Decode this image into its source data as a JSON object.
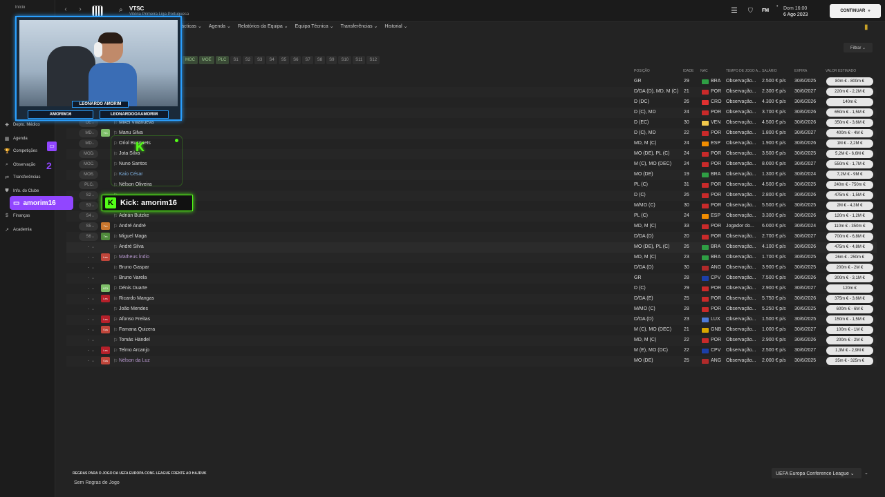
{
  "topbar": {
    "back": "‹",
    "forward": "›",
    "team_name": "VTSC",
    "team_sub": "Vitória Primeira Liga Portuguesa",
    "day": "Dom 16:00",
    "date": "6 Ago 2023",
    "fm_logo": "FM",
    "continue_label": "CONTINUAR",
    "continue_arrow": "»"
  },
  "tabs": [
    "Tácticas ⌄",
    "Agenda ⌄",
    "Relatórios da Equipa ⌄",
    "Equipa Técnica ⌄",
    "Transferências ⌄",
    "Historial ⌄"
  ],
  "filter_label": "Filtrar ⌄",
  "pos_filter": [
    {
      "label": "MOC",
      "on": true
    },
    {
      "label": "MOE",
      "on": true
    },
    {
      "label": "PLC",
      "on": true
    },
    {
      "label": "S1",
      "on": false
    },
    {
      "label": "S2",
      "on": false
    },
    {
      "label": "S3",
      "on": false
    },
    {
      "label": "S4",
      "on": false
    },
    {
      "label": "S5",
      "on": false
    },
    {
      "label": "S6",
      "on": false
    },
    {
      "label": "S7",
      "on": false
    },
    {
      "label": "S8",
      "on": false
    },
    {
      "label": "S9",
      "on": false
    },
    {
      "label": "S10",
      "on": false
    },
    {
      "label": "S11",
      "on": false
    },
    {
      "label": "S12",
      "on": false
    }
  ],
  "columns": {
    "posicao": "POSIÇÃO",
    "idade": "IDADE",
    "nac": "NAC",
    "tempo": "TEMPO DE JOGO A...",
    "salario": "SALÁRIO",
    "expira": "EXPIRA",
    "valor": "VALOR ESTIMADO"
  },
  "sidebar": {
    "top_label": "Início",
    "items": [
      {
        "label": "Depto. Médico",
        "icon": "✚"
      },
      {
        "label": "Agenda",
        "icon": "▦"
      },
      {
        "label": "Competições",
        "icon": "🏆"
      },
      {
        "label": "Observação",
        "icon": "⌕"
      },
      {
        "label": "Transferências",
        "icon": "⇄"
      },
      {
        "label": "Info. do Clube",
        "icon": "⛊"
      },
      {
        "label": "Finanças",
        "icon": "$"
      },
      {
        "label": "Academia",
        "icon": "↗"
      }
    ]
  },
  "players": [
    {
      "pos": "",
      "badge": "",
      "badge_color": "",
      "name": "",
      "position": "GR",
      "age": "29",
      "flag": "#2f9e44",
      "nat": "BRA",
      "status": "Observação...",
      "salary": "2.500 € p/s",
      "expires": "30/6/2025",
      "value": "80m € - 800m €",
      "style": ""
    },
    {
      "pos": "",
      "badge": "",
      "badge_color": "",
      "name": "",
      "position": "D/DA (D), MD, M (C)",
      "age": "21",
      "flag": "#c92a2a",
      "nat": "POR",
      "status": "Observação...",
      "salary": "2.300 € p/s",
      "expires": "30/6/2027",
      "value": "220m € - 2,2M €",
      "style": ""
    },
    {
      "pos": "",
      "badge": "",
      "badge_color": "",
      "name": "",
      "position": "D (DC)",
      "age": "26",
      "flag": "#e03131",
      "nat": "CRO",
      "status": "Observação...",
      "salary": "4.300 € p/s",
      "expires": "30/6/2026",
      "value": "140m €",
      "style": ""
    },
    {
      "pos": "",
      "badge": "",
      "badge_color": "",
      "name": "",
      "position": "D (C), MD",
      "age": "24",
      "flag": "#c92a2a",
      "nat": "POR",
      "status": "Observação...",
      "salary": "3.700 € p/s",
      "expires": "30/6/2026",
      "value": "650m € - 1,5M €",
      "style": ""
    },
    {
      "pos": "DE",
      "badge": "",
      "badge_color": "",
      "name": "Mikel Villanueva",
      "position": "D (EC)",
      "age": "30",
      "flag": "#f2c94c",
      "nat": "VEN",
      "status": "Observação...",
      "salary": "4.500 € p/s",
      "expires": "30/6/2026",
      "value": "350m € - 3,6M €",
      "style": ""
    },
    {
      "pos": "MD",
      "badge": "Trn",
      "badge_color": "#7fbf6a",
      "name": "Manu Silva",
      "position": "D (C), MD",
      "age": "22",
      "flag": "#c92a2a",
      "nat": "POR",
      "status": "Observação...",
      "salary": "1.800 € p/s",
      "expires": "30/6/2027",
      "value": "400m € - 4M €",
      "style": ""
    },
    {
      "pos": "MD",
      "badge": "",
      "badge_color": "",
      "name": "Oriol Busquets",
      "position": "MD, M (C)",
      "age": "24",
      "flag": "#f08c00",
      "nat": "ESP",
      "status": "Observação...",
      "salary": "1.900 € p/s",
      "expires": "30/6/2026",
      "value": "1M € - 2,2M €",
      "style": ""
    },
    {
      "pos": "MOD",
      "badge": "",
      "badge_color": "",
      "name": "Jota Silva",
      "position": "MO (DE), PL (C)",
      "age": "24",
      "flag": "#c92a2a",
      "nat": "POR",
      "status": "Observação...",
      "salary": "3.500 € p/s",
      "expires": "30/6/2025",
      "value": "5,2M € - 6,6M €",
      "style": ""
    },
    {
      "pos": "MOC",
      "badge": "",
      "badge_color": "",
      "name": "Nuno Santos",
      "position": "M (C), MO (DEC)",
      "age": "24",
      "flag": "#c92a2a",
      "nat": "POR",
      "status": "Observação...",
      "salary": "8.000 € p/s",
      "expires": "30/6/2027",
      "value": "550m € - 1,7M €",
      "style": ""
    },
    {
      "pos": "MOE",
      "badge": "",
      "badge_color": "",
      "name": "Kaio César",
      "position": "MO (DE)",
      "age": "19",
      "flag": "#2f9e44",
      "nat": "BRA",
      "status": "Observação...",
      "salary": "1.300 € p/s",
      "expires": "30/6/2024",
      "value": "7,2M € - 9M €",
      "style": "blue"
    },
    {
      "pos": "PLC",
      "badge": "",
      "badge_color": "",
      "name": "Nélson Oliveira",
      "position": "PL (C)",
      "age": "31",
      "flag": "#c92a2a",
      "nat": "POR",
      "status": "Observação...",
      "salary": "4.500 € p/s",
      "expires": "30/6/2025",
      "value": "240m € - 750m €",
      "style": ""
    },
    {
      "pos": "S2",
      "badge": "",
      "badge_color": "",
      "name": "",
      "position": "D (C)",
      "age": "26",
      "flag": "#c92a2a",
      "nat": "POR",
      "status": "Observação...",
      "salary": "2.800 € p/s",
      "expires": "30/6/2026",
      "value": "475m € - 1,5M €",
      "style": ""
    },
    {
      "pos": "S3",
      "badge": "",
      "badge_color": "",
      "name": "",
      "position": "M/MO (C)",
      "age": "30",
      "flag": "#c92a2a",
      "nat": "POR",
      "status": "Observação...",
      "salary": "5.500 € p/s",
      "expires": "30/6/2025",
      "value": "2M € - 4,3M €",
      "style": ""
    },
    {
      "pos": "S4",
      "badge": "",
      "badge_color": "",
      "name": "Adrián Butzke",
      "position": "PL (C)",
      "age": "24",
      "flag": "#f08c00",
      "nat": "ESP",
      "status": "Observação...",
      "salary": "3.300 € p/s",
      "expires": "30/6/2026",
      "value": "120m € - 1,2M €",
      "style": ""
    },
    {
      "pos": "S5",
      "badge": "Trn",
      "badge_color": "#c9772e",
      "name": "André André",
      "position": "MD, M (C)",
      "age": "33",
      "flag": "#c92a2a",
      "nat": "POR",
      "status": "Jogador do...",
      "salary": "6.000 € p/s",
      "expires": "30/6/2024",
      "value": "110m € - 350m €",
      "style": ""
    },
    {
      "pos": "S6",
      "badge": "Trn",
      "badge_color": "#4f8a3c",
      "name": "Miguel Maga",
      "position": "D/DA (D)",
      "age": "20",
      "flag": "#c92a2a",
      "nat": "POR",
      "status": "Observação...",
      "salary": "2.700 € p/s",
      "expires": "30/6/2027",
      "value": "700m € - 6,8M €",
      "style": ""
    },
    {
      "pos": "-",
      "badge": "",
      "badge_color": "",
      "name": "André Silva",
      "position": "MO (DE), PL (C)",
      "age": "26",
      "flag": "#2f9e44",
      "nat": "BRA",
      "status": "Observação...",
      "salary": "4.100 € p/s",
      "expires": "30/6/2026",
      "value": "475m € - 4,8M €",
      "style": "reserve"
    },
    {
      "pos": "-",
      "badge": "Les",
      "badge_color": "#c0463b",
      "name": "Matheus Índio",
      "position": "MD, M (C)",
      "age": "23",
      "flag": "#2f9e44",
      "nat": "BRA",
      "status": "Observação...",
      "salary": "1.700 € p/s",
      "expires": "30/6/2025",
      "value": "26m € - 250m €",
      "style": "purple"
    },
    {
      "pos": "-",
      "badge": "",
      "badge_color": "",
      "name": "Bruno Gaspar",
      "position": "D/DA (D)",
      "age": "30",
      "flag": "#b02a2a",
      "nat": "ANG",
      "status": "Observação...",
      "salary": "3.900 € p/s",
      "expires": "30/6/2025",
      "value": "200m € - 2M €",
      "style": ""
    },
    {
      "pos": "-",
      "badge": "",
      "badge_color": "",
      "name": "Bruno Varela",
      "position": "GR",
      "age": "28",
      "flag": "#1c3fa8",
      "nat": "CPV",
      "status": "Observação...",
      "salary": "7.500 € p/s",
      "expires": "30/6/2026",
      "value": "300m € - 3,1M €",
      "style": ""
    },
    {
      "pos": "-",
      "badge": "U21",
      "badge_color": "#7fbf6a",
      "name": "Dénis Duarte",
      "position": "D (C)",
      "age": "29",
      "flag": "#c92a2a",
      "nat": "POR",
      "status": "Observação...",
      "salary": "2.900 € p/s",
      "expires": "30/6/2027",
      "value": "120m €",
      "style": ""
    },
    {
      "pos": "-",
      "badge": "Les",
      "badge_color": "#b5202a",
      "name": "Ricardo Mangas",
      "position": "D/DA (E)",
      "age": "25",
      "flag": "#c92a2a",
      "nat": "POR",
      "status": "Observação...",
      "salary": "5.750 € p/s",
      "expires": "30/6/2026",
      "value": "375m € - 3,6M €",
      "style": ""
    },
    {
      "pos": "-",
      "badge": "",
      "badge_color": "",
      "name": "João Mendes",
      "position": "M/MO (C)",
      "age": "28",
      "flag": "#c92a2a",
      "nat": "POR",
      "status": "Observação...",
      "salary": "5.250 € p/s",
      "expires": "30/6/2025",
      "value": "600m € - 6M €",
      "style": ""
    },
    {
      "pos": "-",
      "badge": "Les",
      "badge_color": "#b5202a",
      "name": "Afonso Freitas",
      "position": "D/DA (D)",
      "age": "23",
      "flag": "#4d7ad8",
      "nat": "LUX",
      "status": "Observação...",
      "salary": "1.500 € p/s",
      "expires": "30/6/2025",
      "value": "150m € - 1,5M €",
      "style": ""
    },
    {
      "pos": "-",
      "badge": "Sus",
      "badge_color": "#c0463b",
      "name": "Famana Quizera",
      "position": "M (C), MO (DEC)",
      "age": "21",
      "flag": "#d9a700",
      "nat": "GNB",
      "status": "Observação...",
      "salary": "1.000 € p/s",
      "expires": "30/6/2027",
      "value": "100m € - 1M €",
      "style": ""
    },
    {
      "pos": "-",
      "badge": "",
      "badge_color": "",
      "name": "Tomás Händel",
      "position": "MD, M (C)",
      "age": "22",
      "flag": "#c92a2a",
      "nat": "POR",
      "status": "Observação...",
      "salary": "2.900 € p/s",
      "expires": "30/6/2026",
      "value": "200m € - 2M €",
      "style": ""
    },
    {
      "pos": "-",
      "badge": "Les",
      "badge_color": "#b5202a",
      "name": "Telmo Arcanjo",
      "position": "M (E), MO (DC)",
      "age": "22",
      "flag": "#1c3fa8",
      "nat": "CPV",
      "status": "Observação...",
      "salary": "2.500 € p/s",
      "expires": "30/6/2027",
      "value": "1,3M € - 2,9M €",
      "style": ""
    },
    {
      "pos": "-",
      "badge": "Sus",
      "badge_color": "#c0463b",
      "name": "Nélson da Luz",
      "position": "MO (DE)",
      "age": "25",
      "flag": "#b02a2a",
      "nat": "ANG",
      "status": "Observação...",
      "salary": "2.000 € p/s",
      "expires": "30/6/2025",
      "value": "35m € - 325m €",
      "style": "purple"
    }
  ],
  "footer": {
    "rules_title": "REGRAS PARA O JOGO DA UEFA EUROPA CONF. LEAGUE FRENTE AO HAJDUK",
    "rules_value": "Sem Regras de Jogo",
    "competition": "UEFA Europa Conference League ⌄"
  },
  "overlays": {
    "webcam_name": "LEONARDO AMORIM",
    "twitch_handle": "AMORIM16",
    "ig_handle": "LEONARDOOAAMORIM",
    "kick_text": "Kick: amorim16",
    "kick_logo": "K",
    "twitch_overlay": "amorim16",
    "twitch_num": "2"
  }
}
